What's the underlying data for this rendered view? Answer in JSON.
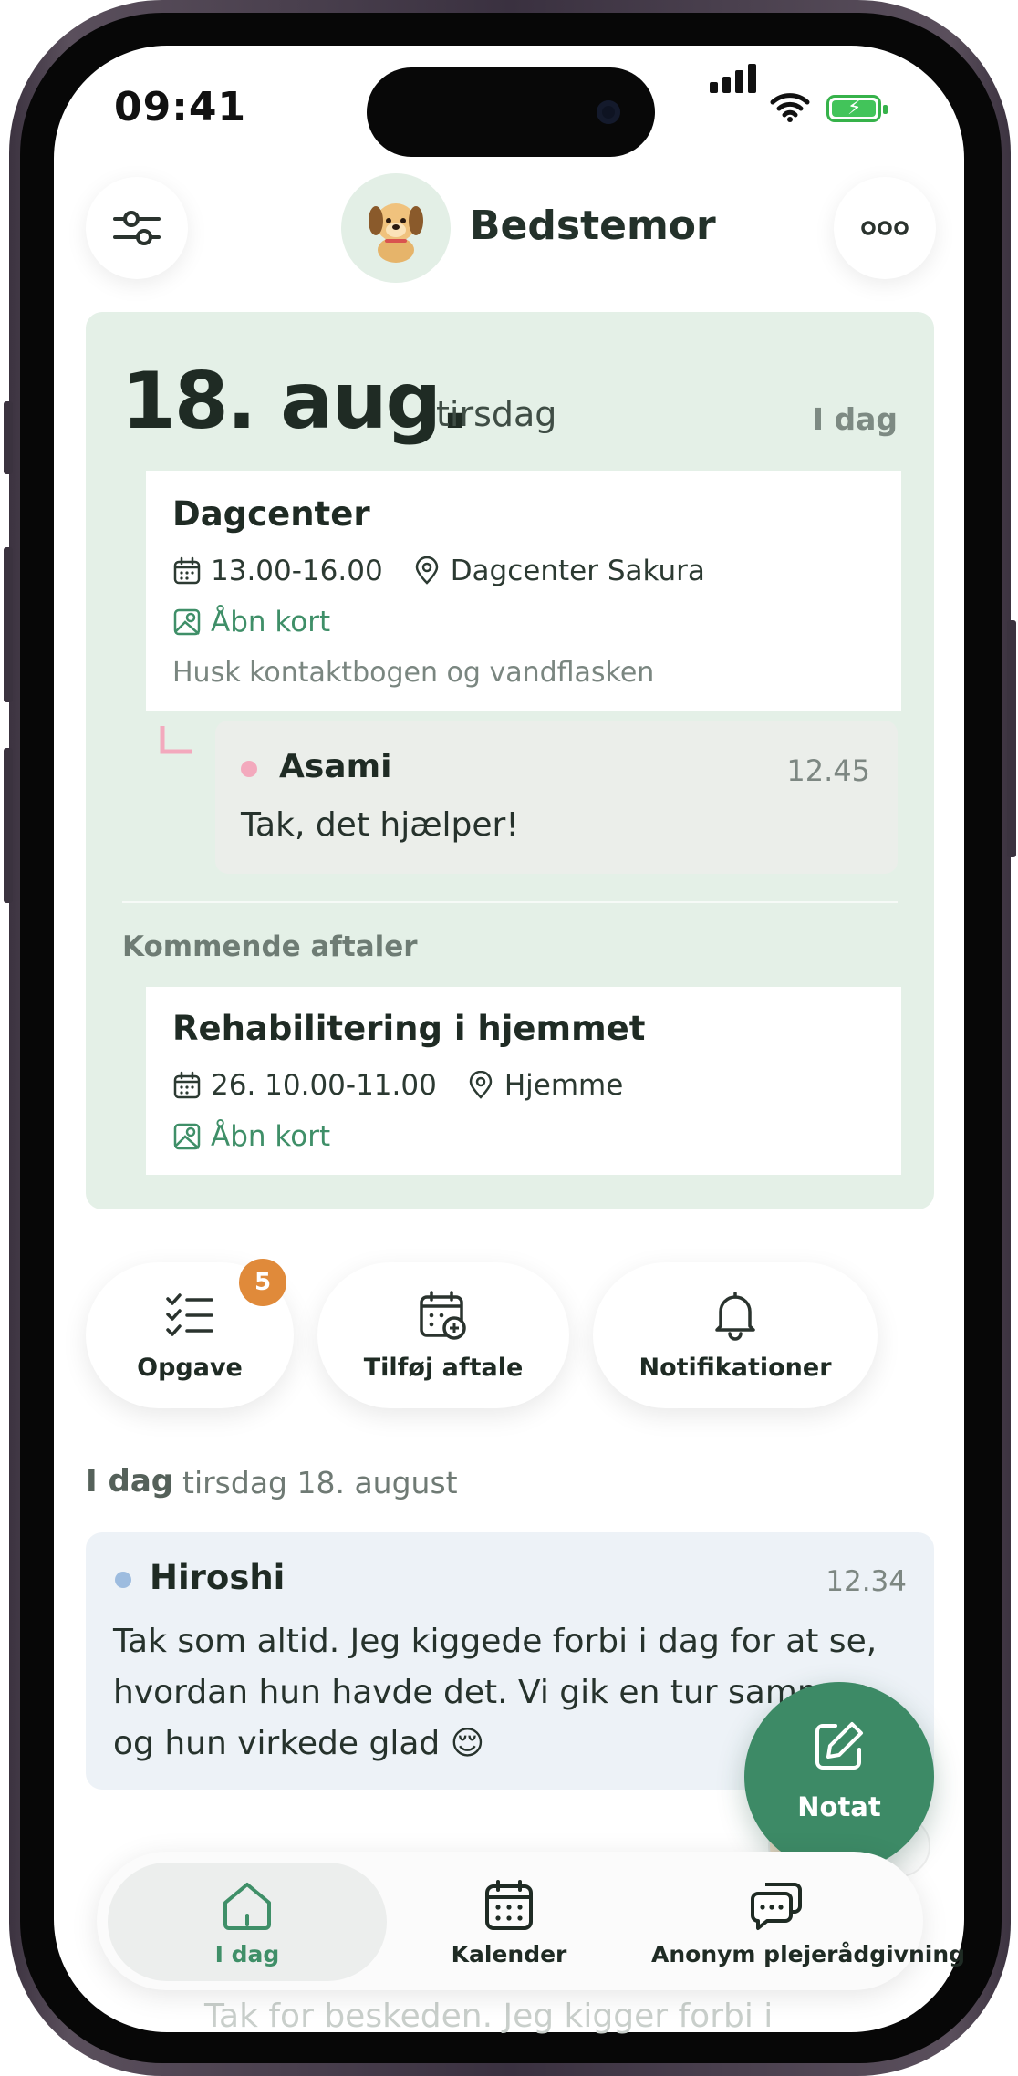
{
  "status_bar": {
    "time": "09:41"
  },
  "header": {
    "name": "Bedstemor",
    "filter_icon": "sliders-icon",
    "more_icon": "ellipsis-icon",
    "avatar_icon": "puppy-icon"
  },
  "today_card": {
    "date": "18. aug.",
    "weekday": "tirsdag",
    "today_label": "I dag",
    "event": {
      "title": "Dagcenter",
      "time": "13.00-16.00",
      "location": "Dagcenter Sakura",
      "map_link": "Åbn kort",
      "note": "Husk kontaktbogen og vandflasken"
    },
    "reply": {
      "author": "Asami",
      "time": "12.45",
      "text": "Tak, det hjælper!"
    },
    "upcoming_label": "Kommende aftaler",
    "upcoming_event": {
      "title": "Rehabilitering i hjemmet",
      "time": "26. 10.00-11.00",
      "location": "Hjemme",
      "map_link": "Åbn kort"
    }
  },
  "actions": {
    "task_label": "Opgave",
    "task_badge": "5",
    "add_label": "Tilføj aftale",
    "notify_label": "Notifikationer"
  },
  "feed": {
    "day_label": "I dag",
    "date_label": "tirsdag 18. august",
    "message": {
      "author": "Hiroshi",
      "time": "12.34",
      "text": "Tak som altid. Jeg kiggede forbi i dag for at se, hvordan hun havde det. Vi gik en tur sammen, og hun virkede glad 😌"
    },
    "next_preview": "Tak for beskeden. Jeg kigger forbi i"
  },
  "fab": {
    "label": "Notat"
  },
  "tabbar": {
    "tabs": [
      {
        "label": "I dag",
        "icon": "home-icon"
      },
      {
        "label": "Kalender",
        "icon": "calendar-icon"
      },
      {
        "label": "Anonym plejerådgivning",
        "icon": "chat-icon"
      }
    ]
  },
  "colors": {
    "accent": "#3d8a66",
    "card_bg": "#e4f0e7",
    "badge": "#e08a3a"
  }
}
